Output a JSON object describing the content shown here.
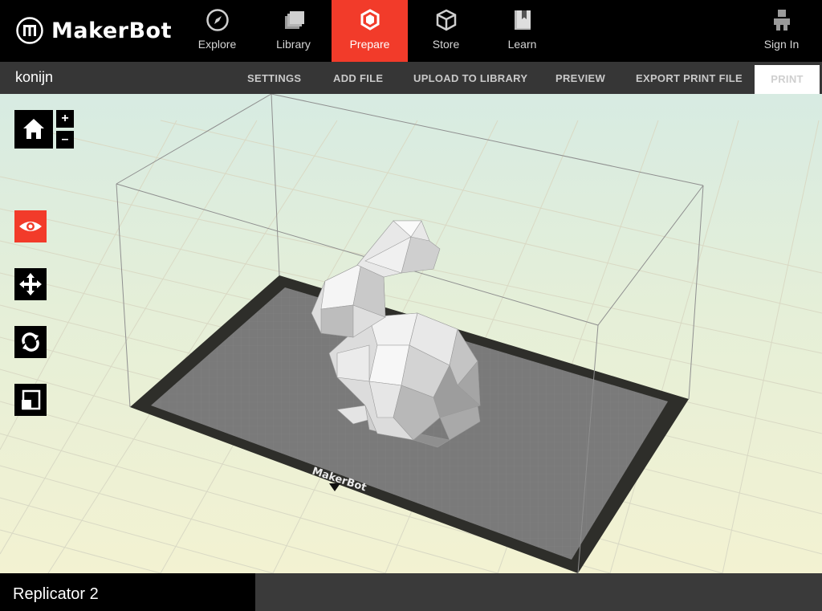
{
  "brand": {
    "name": "MakerBot"
  },
  "nav": {
    "items": [
      {
        "label": "Explore",
        "icon": "compass-icon"
      },
      {
        "label": "Library",
        "icon": "library-icon"
      },
      {
        "label": "Prepare",
        "icon": "prepare-icon",
        "active": true
      },
      {
        "label": "Store",
        "icon": "store-box-icon"
      },
      {
        "label": "Learn",
        "icon": "learn-book-icon"
      }
    ],
    "sign_in": "Sign In"
  },
  "toolbar": {
    "project_name": "konijn",
    "settings": "SETTINGS",
    "add_file": "ADD FILE",
    "upload": "UPLOAD TO LIBRARY",
    "preview": "PREVIEW",
    "export": "EXPORT PRINT FILE",
    "print": "PRINT"
  },
  "viewport": {
    "zoom_in": "+",
    "zoom_out": "–",
    "plate_label": "MakerBot",
    "tools": [
      "look-eye-icon",
      "move-arrows-icon",
      "rotate-icon",
      "scale-icon"
    ],
    "active_tool": "look-eye-icon",
    "accent_color": "#f23b2a"
  },
  "footer": {
    "printer": "Replicator 2"
  }
}
